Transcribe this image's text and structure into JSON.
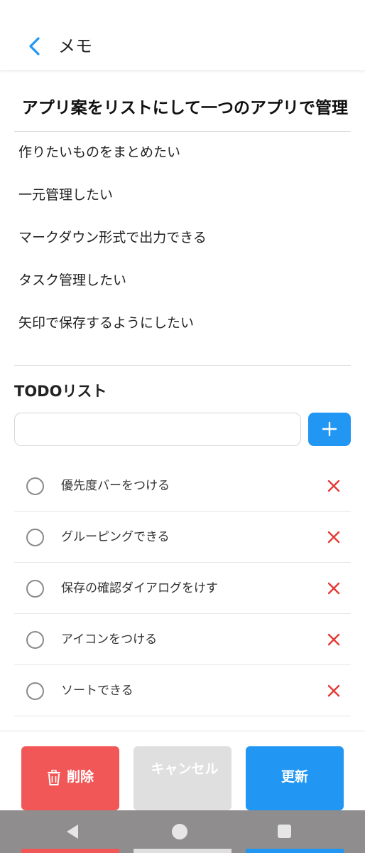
{
  "header": {
    "back_icon": "chevron-left-icon",
    "title": "メモ"
  },
  "memo": {
    "title": "アプリ案をリストにして一つのアプリで管理",
    "lines": [
      "作りたいものをまとめたい",
      "一元管理したい",
      "マークダウン形式で出力できる",
      "タスク管理したい",
      "矢印で保存するようにしたい"
    ]
  },
  "todo": {
    "heading": "TODOリスト",
    "input_value": "",
    "input_placeholder": "",
    "add_icon": "plus-icon",
    "items": [
      {
        "text": "優先度バーをつける",
        "done": false
      },
      {
        "text": "グルーピングできる",
        "done": false
      },
      {
        "text": "保存の確認ダイアログをけす",
        "done": false
      },
      {
        "text": "アイコンをつける",
        "done": false
      },
      {
        "text": "ソートできる",
        "done": false
      }
    ],
    "delete_icon": "close-icon"
  },
  "actions": {
    "delete_label": "削除",
    "delete_icon": "trash-icon",
    "cancel_label": "キャンセル",
    "update_label": "更新"
  },
  "colors": {
    "accent_blue": "#2196f3",
    "danger_red": "#f25757",
    "disabled_gray": "#dfdfdf",
    "delete_x_red": "#e53935",
    "nav_bar_gray": "#8f8d8d"
  },
  "system_nav": {
    "back_icon": "nav-back-triangle-icon",
    "home_icon": "nav-home-circle-icon",
    "recent_icon": "nav-recent-square-icon"
  }
}
